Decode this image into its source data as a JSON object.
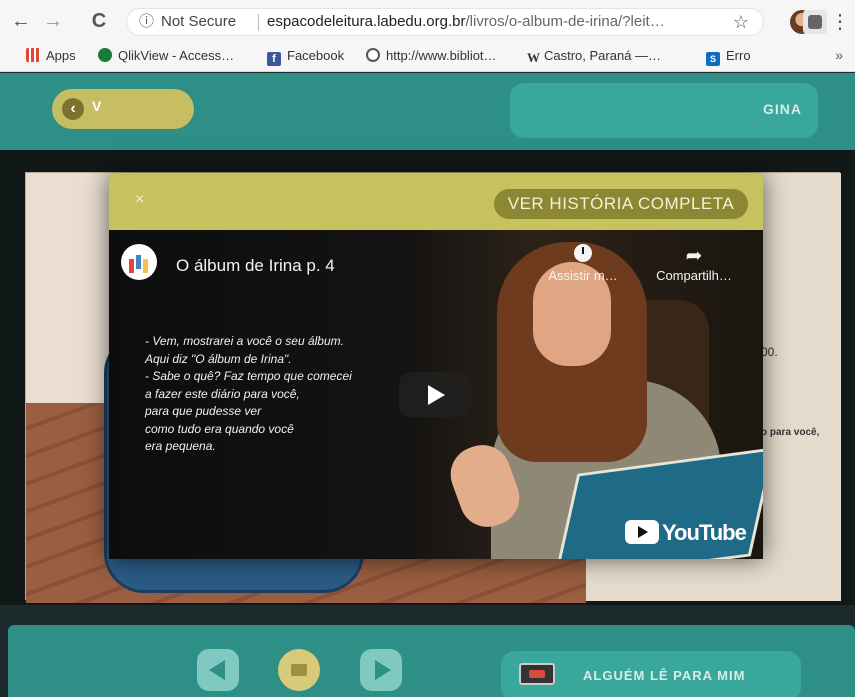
{
  "browser": {
    "back": "←",
    "forward": "→",
    "reload": "C",
    "info_icon": "ⓘ",
    "security": "Not Secure",
    "url_domain": "espacodeleitura.labedu.org.br",
    "url_path": "/livros/o-album-de-irina/?leit…",
    "star": "☆",
    "menu": "⋮"
  },
  "bookmarks": [
    {
      "label": "Apps",
      "icon": "apps-icon"
    },
    {
      "label": "QlikView - Access…",
      "icon": "qlikview-icon"
    },
    {
      "label": "Facebook",
      "icon": "facebook-icon",
      "glyph": "f"
    },
    {
      "label": "http://www.bibliot…",
      "icon": "globe-icon"
    },
    {
      "label": "Castro, Paraná —…",
      "icon": "wikipedia-icon",
      "glyph": "W"
    },
    {
      "label": "Erro",
      "icon": "sharepoint-icon",
      "glyph": "S"
    }
  ],
  "bookmarks_overflow": "»",
  "app": {
    "back_label": "V",
    "page_label": "GINA",
    "read_for_me": "ALGUÉM LÊ PARA MIM",
    "book_fragment_1": "00.",
    "book_fragment_2": "o para você,"
  },
  "modal": {
    "close": "×",
    "full_story": "VER HISTÓRIA COMPLETA",
    "video": {
      "title": "O álbum de Irina p. 4",
      "watch_later": "Assistir m…",
      "share": "Compartilh…",
      "share_glyph": "➦",
      "subtitles": [
        "- Vem, mostrarei a você o seu álbum.",
        "  Aqui diz \"O álbum de Irina\".",
        "- Sabe o quê? Faz tempo que comecei",
        "  a fazer este diário para você,",
        "  para que pudesse ver",
        "  como tudo era quando você",
        "  era pequena."
      ],
      "brand": "YouTube"
    }
  }
}
